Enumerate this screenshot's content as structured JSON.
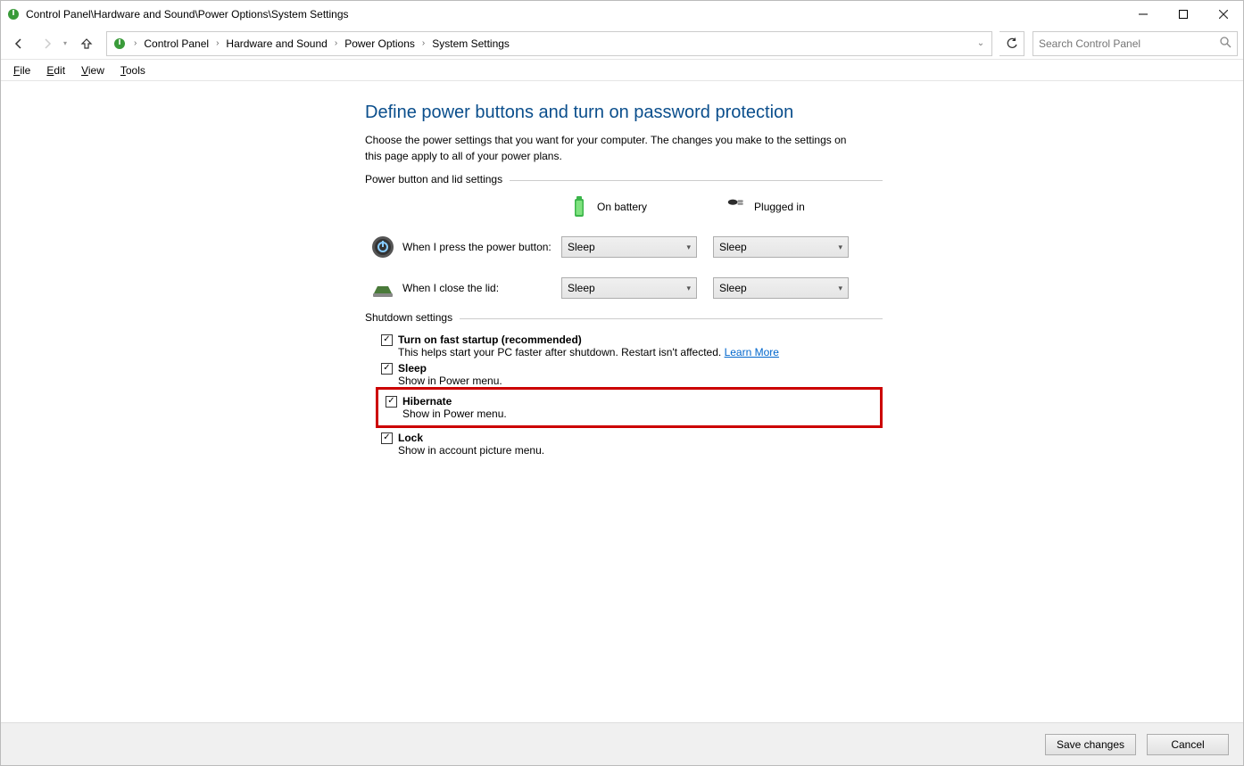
{
  "window": {
    "title": "Control Panel\\Hardware and Sound\\Power Options\\System Settings"
  },
  "breadcrumb": {
    "items": [
      "Control Panel",
      "Hardware and Sound",
      "Power Options",
      "System Settings"
    ]
  },
  "search": {
    "placeholder": "Search Control Panel"
  },
  "menu": {
    "file": "File",
    "edit": "Edit",
    "view": "View",
    "tools": "Tools"
  },
  "page": {
    "title": "Define power buttons and turn on password protection",
    "subtitle": "Choose the power settings that you want for your computer. The changes you make to the settings on this page apply to all of your power plans."
  },
  "group_power": {
    "label": "Power button and lid settings",
    "col_battery": "On battery",
    "col_plugged": "Plugged in",
    "row_power_button": "When I press the power button:",
    "row_lid": "When I close the lid:",
    "val_power_battery": "Sleep",
    "val_power_plugged": "Sleep",
    "val_lid_battery": "Sleep",
    "val_lid_plugged": "Sleep"
  },
  "group_shutdown": {
    "label": "Shutdown settings",
    "fast_startup": {
      "title": "Turn on fast startup (recommended)",
      "desc": "This helps start your PC faster after shutdown. Restart isn't affected. ",
      "link": "Learn More",
      "checked": true
    },
    "sleep": {
      "title": "Sleep",
      "desc": "Show in Power menu.",
      "checked": true
    },
    "hibernate": {
      "title": "Hibernate",
      "desc": "Show in Power menu.",
      "checked": true
    },
    "lock": {
      "title": "Lock",
      "desc": "Show in account picture menu.",
      "checked": true
    }
  },
  "footer": {
    "save": "Save changes",
    "cancel": "Cancel"
  }
}
